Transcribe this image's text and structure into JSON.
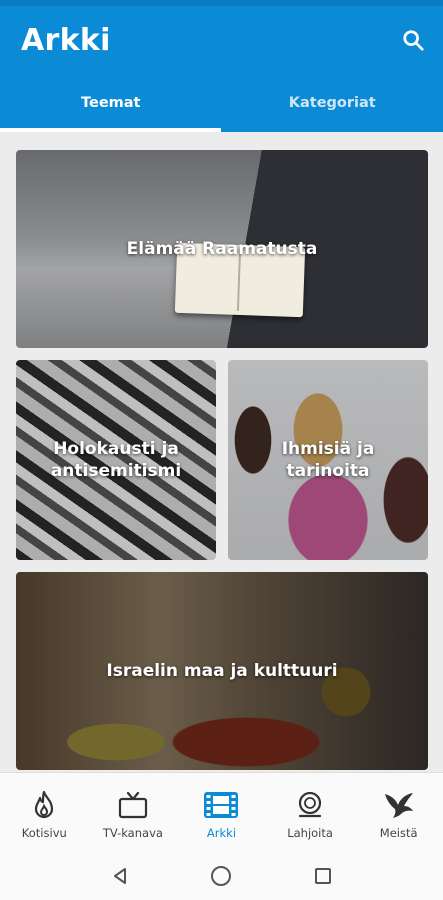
{
  "app": {
    "title": "Arkki"
  },
  "tabs": [
    {
      "label": "Teemat",
      "active": true
    },
    {
      "label": "Kategoriat",
      "active": false
    }
  ],
  "categories": [
    {
      "label": "Elämää Raamatusta"
    },
    {
      "label": "Holokausti ja antisemitismi"
    },
    {
      "label": "Ihmisiä ja tarinoita"
    },
    {
      "label": "Israelin maa ja kulttuuri"
    }
  ],
  "bottom_nav": [
    {
      "label": "Kotisivu",
      "icon": "flame-icon",
      "active": false
    },
    {
      "label": "TV-kanava",
      "icon": "tv-icon",
      "active": false
    },
    {
      "label": "Arkki",
      "icon": "film-icon",
      "active": true
    },
    {
      "label": "Lahjoita",
      "icon": "coin-icon",
      "active": false
    },
    {
      "label": "Meistä",
      "icon": "dove-icon",
      "active": false
    }
  ],
  "colors": {
    "primary": "#0b8bd6",
    "active_nav": "#0b8bd6"
  }
}
